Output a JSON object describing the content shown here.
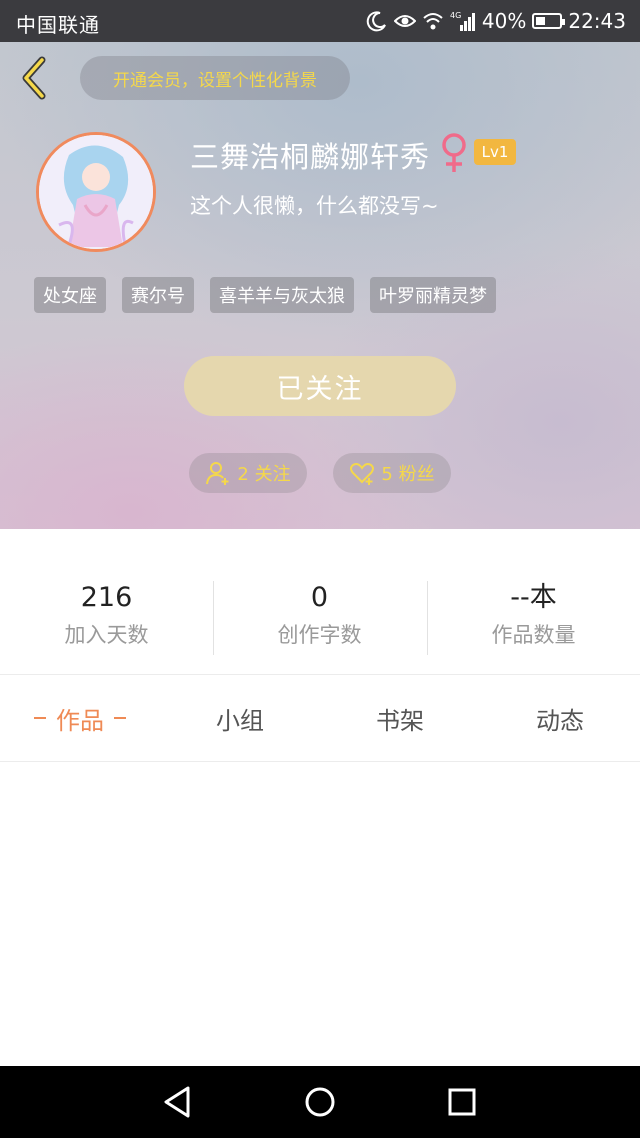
{
  "status_bar": {
    "carrier": "中国联通",
    "network": "4G",
    "battery_text": "40%",
    "battery_level": 0.4,
    "time": "22:43",
    "icons": [
      "moon-icon",
      "eye-icon",
      "wifi-icon",
      "signal-icon",
      "battery-icon"
    ]
  },
  "header": {
    "vip_prompt": "开通会员，设置个性化背景",
    "username": "三舞浩桐麟娜轩秀",
    "gender": "female",
    "level": "Lv1",
    "bio": "这个人很懒，什么都没写~",
    "tags": [
      "处女座",
      "赛尔号",
      "喜羊羊与灰太狼",
      "叶罗丽精灵梦"
    ],
    "follow_button": "已关注",
    "following_count_label": "2 关注",
    "fans_count_label": "5 粉丝"
  },
  "stats": [
    {
      "value": "216",
      "label": "加入天数"
    },
    {
      "value": "0",
      "label": "创作字数"
    },
    {
      "value": "--本",
      "label": "作品数量"
    }
  ],
  "tabs": [
    {
      "label": "作品",
      "active": true
    },
    {
      "label": "小组",
      "active": false
    },
    {
      "label": "书架",
      "active": false
    },
    {
      "label": "动态",
      "active": false
    }
  ],
  "colors": {
    "accent": "#ef8a55",
    "vip_text": "#f5d84a",
    "follow_button": "#e5d7ae",
    "level_badge": "#f2b740",
    "gender_symbol": "#f06b8a"
  }
}
